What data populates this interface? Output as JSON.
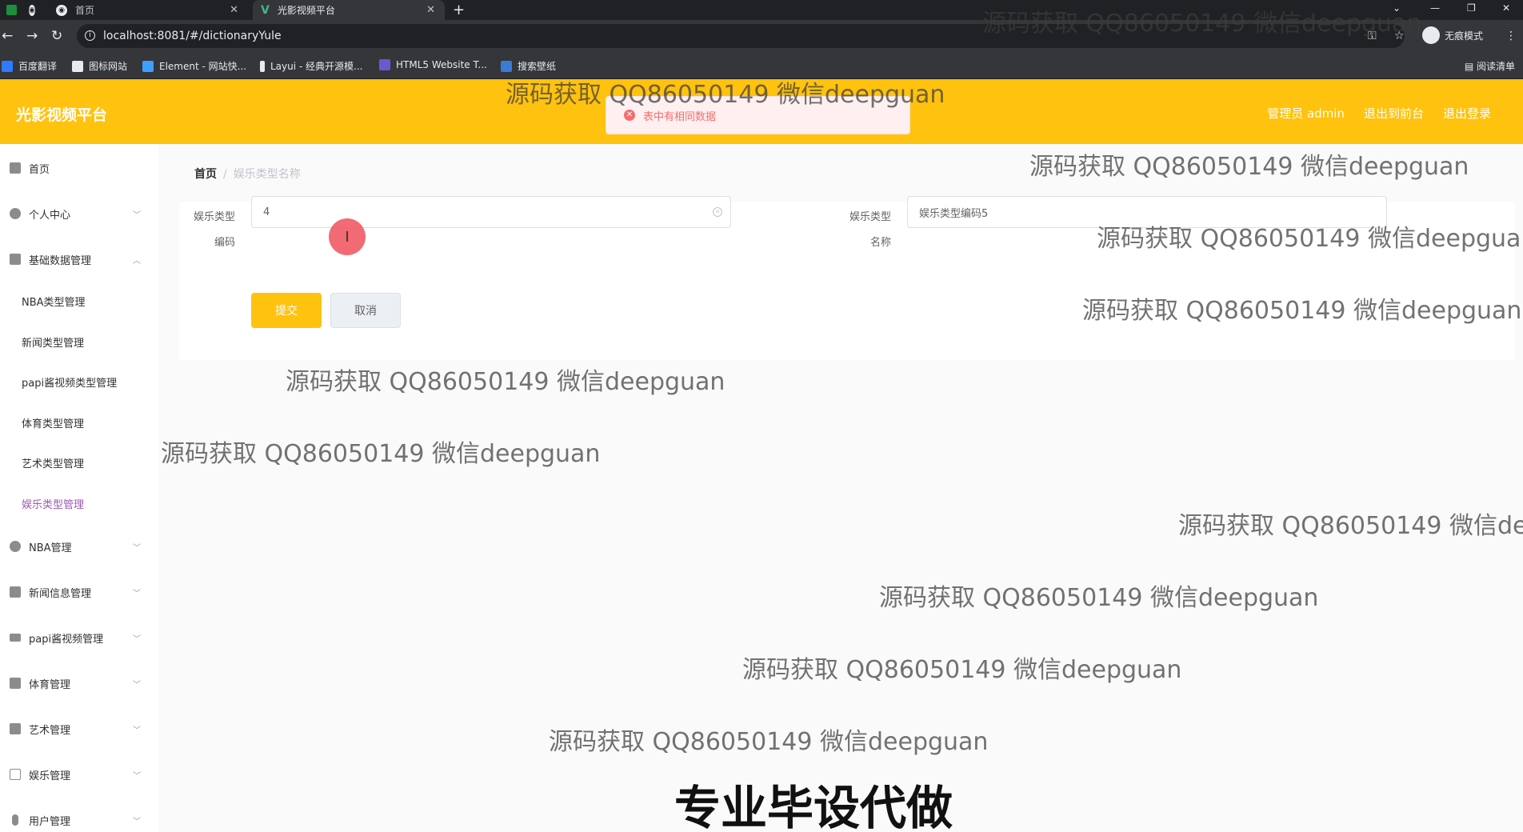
{
  "browser": {
    "tabs": [
      {
        "label": "首页",
        "active": false
      },
      {
        "label": "光影视频平台",
        "active": true
      }
    ],
    "url": "localhost:8081/#/dictionaryYule",
    "incognito_label": "无痕模式",
    "reading_list": "阅读清单",
    "bookmarks": [
      {
        "label": "百度翻译",
        "color": "#2e7bff"
      },
      {
        "label": "图标网站",
        "color": "#ffffff"
      },
      {
        "label": "Element - 网站快...",
        "color": "#409eff"
      },
      {
        "label": "Layui - 经典开源模...",
        "color": "#ffffff"
      },
      {
        "label": "HTML5 Website T...",
        "color": "#6a5acd"
      },
      {
        "label": "搜索壁纸",
        "color": "#3a7bd5"
      }
    ]
  },
  "header": {
    "title": "光影视频平台",
    "links": [
      "管理员 admin",
      "退出到前台",
      "退出登录"
    ],
    "accent": "#ffc20e"
  },
  "toast": {
    "message": "表中有相同数据",
    "type": "error"
  },
  "sidebar": {
    "items": [
      {
        "label": "首页",
        "icon": "home-icon"
      },
      {
        "label": "个人中心",
        "icon": "user-icon",
        "chevron": "down"
      },
      {
        "label": "基础数据管理",
        "icon": "send-icon",
        "chevron": "up"
      },
      {
        "label": "NBA管理",
        "icon": "circle-icon",
        "chevron": "down"
      },
      {
        "label": "新闻信息管理",
        "icon": "message-icon",
        "chevron": "down"
      },
      {
        "label": "papi酱视频管理",
        "icon": "menu-icon",
        "chevron": "down"
      },
      {
        "label": "体育管理",
        "icon": "chart-icon",
        "chevron": "down"
      },
      {
        "label": "艺术管理",
        "icon": "clipboard-icon",
        "chevron": "down"
      },
      {
        "label": "娱乐管理",
        "icon": "chat-icon",
        "chevron": "down"
      },
      {
        "label": "用户管理",
        "icon": "mic-icon",
        "chevron": "down"
      }
    ],
    "sub_items": [
      {
        "label": "NBA类型管理",
        "active": false
      },
      {
        "label": "新闻类型管理",
        "active": false
      },
      {
        "label": "papi酱视频类型管理",
        "active": false
      },
      {
        "label": "体育类型管理",
        "active": false
      },
      {
        "label": "艺术类型管理",
        "active": false
      },
      {
        "label": "娱乐类型管理",
        "active": true
      }
    ]
  },
  "breadcrumb": {
    "home": "首页",
    "separator": "/",
    "current": "娱乐类型名称"
  },
  "form": {
    "code_label_line1": "娱乐类型",
    "code_label_line2": "编码",
    "code_value": "4",
    "name_label_line1": "娱乐类型",
    "name_label_line2": "名称",
    "name_placeholder": "娱乐类型编码5",
    "submit": "提交",
    "cancel": "取消"
  },
  "watermarks": {
    "text": "源码获取 QQ86050149 微信deepguan",
    "text_cut": "源码获取 QQ86050149 微信de",
    "banner": "专业毕设代做"
  }
}
